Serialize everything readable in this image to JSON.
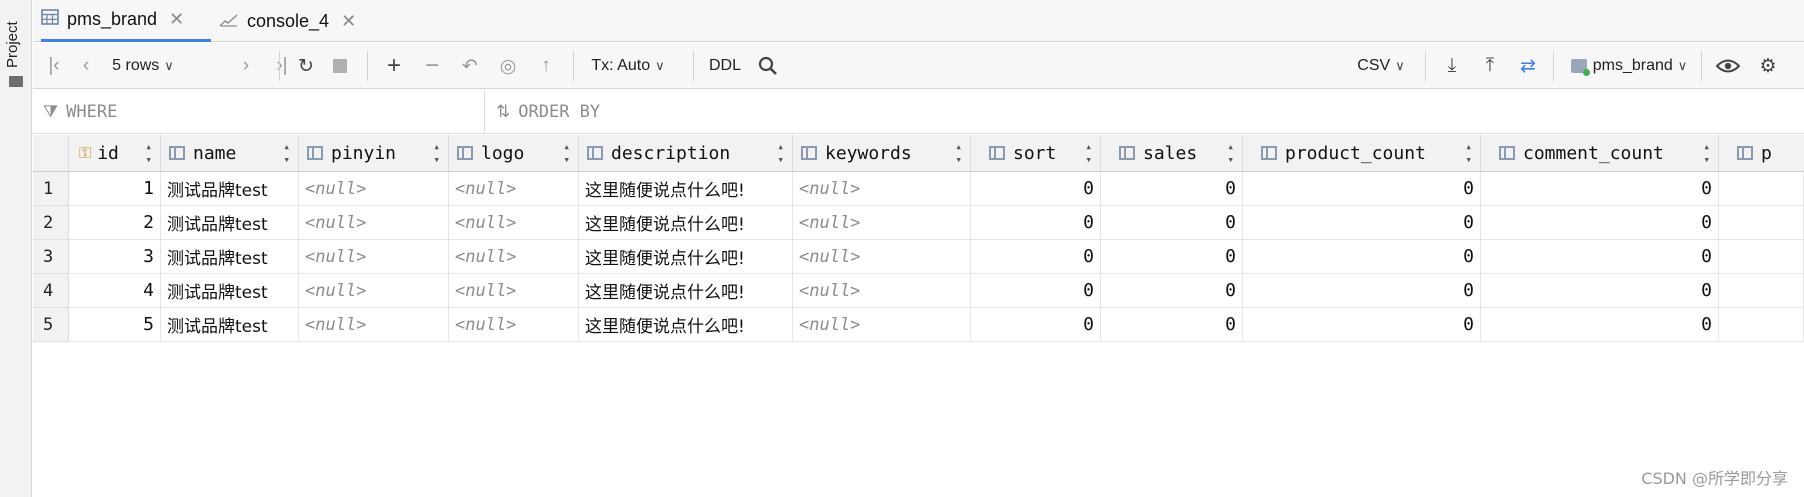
{
  "sidebar": {
    "project_label": "Project"
  },
  "tabs": [
    {
      "label": "pms_brand",
      "close": "✕"
    },
    {
      "label": "console_4",
      "close": "✕"
    }
  ],
  "toolbar": {
    "rows_label": "5 rows",
    "tx_label": "Tx: Auto",
    "ddl_label": "DDL",
    "export_format": "CSV",
    "datasource": "pms_brand"
  },
  "filter": {
    "where": "WHERE",
    "order_by": "ORDER BY"
  },
  "table": {
    "columns": [
      "id",
      "name",
      "pinyin",
      "logo",
      "description",
      "keywords",
      "sort",
      "sales",
      "product_count",
      "comment_count",
      "p"
    ],
    "rows": [
      {
        "num": "1",
        "id": "1",
        "name": "测试品牌test",
        "pinyin": "<null>",
        "logo": "<null>",
        "description": "这里随便说点什么吧!",
        "keywords": "<null>",
        "sort": "0",
        "sales": "0",
        "product_count": "0",
        "comment_count": "0"
      },
      {
        "num": "2",
        "id": "2",
        "name": "测试品牌test",
        "pinyin": "<null>",
        "logo": "<null>",
        "description": "这里随便说点什么吧!",
        "keywords": "<null>",
        "sort": "0",
        "sales": "0",
        "product_count": "0",
        "comment_count": "0"
      },
      {
        "num": "3",
        "id": "3",
        "name": "测试品牌test",
        "pinyin": "<null>",
        "logo": "<null>",
        "description": "这里随便说点什么吧!",
        "keywords": "<null>",
        "sort": "0",
        "sales": "0",
        "product_count": "0",
        "comment_count": "0"
      },
      {
        "num": "4",
        "id": "4",
        "name": "测试品牌test",
        "pinyin": "<null>",
        "logo": "<null>",
        "description": "这里随便说点什么吧!",
        "keywords": "<null>",
        "sort": "0",
        "sales": "0",
        "product_count": "0",
        "comment_count": "0"
      },
      {
        "num": "5",
        "id": "5",
        "name": "测试品牌test",
        "pinyin": "<null>",
        "logo": "<null>",
        "description": "这里随便说点什么吧!",
        "keywords": "<null>",
        "sort": "0",
        "sales": "0",
        "product_count": "0",
        "comment_count": "0"
      }
    ]
  },
  "watermark": "CSDN @所学即分享",
  "icons": [
    "table-icon",
    "console-icon",
    "first-page-icon",
    "prev-page-icon",
    "next-page-icon",
    "last-page-icon",
    "reload-icon",
    "stop-icon",
    "add-row-icon",
    "delete-row-icon",
    "revert-icon",
    "preview-icon",
    "submit-icon",
    "search-icon",
    "download-icon",
    "upload-icon",
    "compare-icon",
    "datasource-icon",
    "eye-icon",
    "gear-icon",
    "filter-icon",
    "sort-icon",
    "key-icon",
    "column-icon"
  ],
  "colors": {
    "accent": "#3d7ff1"
  }
}
